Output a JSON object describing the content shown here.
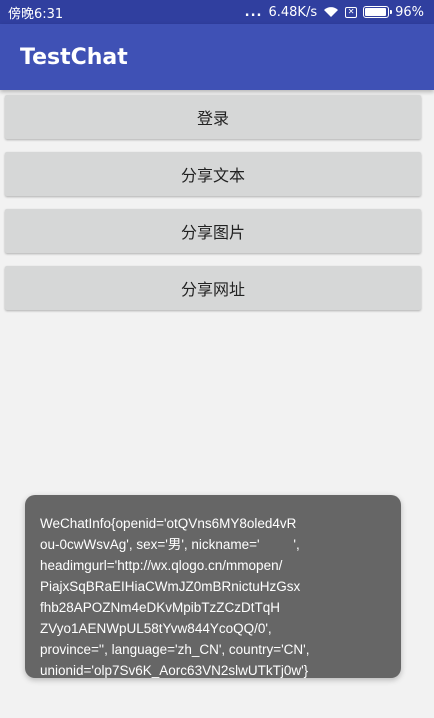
{
  "status_bar": {
    "time": "傍晚6:31",
    "dots": "...",
    "network_speed": "6.48K/s",
    "sim_label": "✕",
    "battery": "96%",
    "battery_level": 0.96
  },
  "app_bar": {
    "title": "TestChat"
  },
  "buttons": {
    "login": "登录",
    "share_text": "分享文本",
    "share_image": "分享图片",
    "share_url": "分享网址"
  },
  "toast": {
    "lines": [
      "WeChatInfo{openid='otQVns6MY8oled4vR",
      "ou-0cwWsvAg', sex='男', nickname='         ',",
      "headimgurl='http://wx.qlogo.cn/mmopen/",
      "PiajxSqBRaEIHiaCWmJZ0mBRnictuHzGsx",
      "fhb28APOZNm4eDKvMpibTzZCzDtTqH",
      "ZVyo1AENWpUL58tYvw844YcoQQ/0',",
      "province='', language='zh_CN', country='CN',",
      "unionid='olp7Sv6K_Aorc63VN2slwUTkTj0w'}"
    ]
  }
}
